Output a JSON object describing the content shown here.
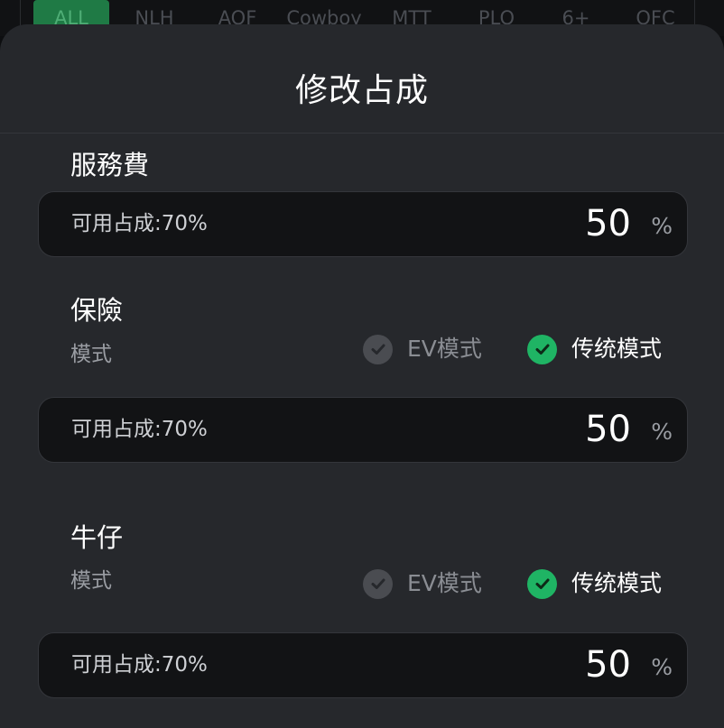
{
  "tabs": [
    {
      "label": "ALL",
      "active": true
    },
    {
      "label": "NLH",
      "active": false
    },
    {
      "label": "AOF",
      "active": false
    },
    {
      "label": "Cowboy",
      "active": false
    },
    {
      "label": "MTT",
      "active": false
    },
    {
      "label": "PLO",
      "active": false
    },
    {
      "label": "6+",
      "active": false
    },
    {
      "label": "OFC",
      "active": false
    }
  ],
  "sheet": {
    "title": "修改占成",
    "sections": [
      {
        "title": "服務費",
        "available": "可用占成:70%",
        "value": "50",
        "unit": "%"
      },
      {
        "title": "保險",
        "mode_label": "模式",
        "options": [
          {
            "label": "EV模式",
            "checked": false
          },
          {
            "label": "传统模式",
            "checked": true
          }
        ],
        "available": "可用占成:70%",
        "value": "50",
        "unit": "%"
      },
      {
        "title": "牛仔",
        "mode_label": "模式",
        "options": [
          {
            "label": "EV模式",
            "checked": false
          },
          {
            "label": "传统模式",
            "checked": true
          }
        ],
        "available": "可用占成:70%",
        "value": "50",
        "unit": "%"
      }
    ]
  },
  "colors": {
    "accent": "#1fb464",
    "sheet_bg": "#26282c",
    "input_bg": "#121315"
  },
  "icons": {
    "check": "check-circle-icon"
  }
}
